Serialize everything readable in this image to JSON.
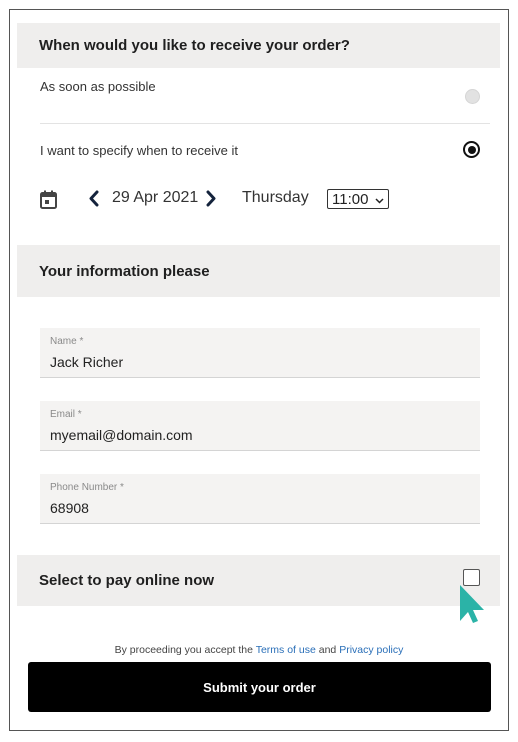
{
  "delivery": {
    "header": "When would you like to receive your order?",
    "option_asap": "As soon as possible",
    "option_specify": "I want to specify when to receive it",
    "selected": "specify",
    "date": "29 Apr 2021",
    "weekday": "Thursday",
    "time_value": "11:00",
    "calendar_icon": "calendar-icon",
    "prev_icon": "chevron-left-icon",
    "next_icon": "chevron-right-icon"
  },
  "info": {
    "header": "Your information please",
    "name_label": "Name *",
    "name_value": "Jack Richer",
    "email_label": "Email *",
    "email_value": "myemail@domain.com",
    "phone_label": "Phone Number *",
    "phone_value": "68908"
  },
  "payment": {
    "header": "Select to pay online now",
    "checked": false
  },
  "footer": {
    "terms_prefix": "By proceeding you accept the",
    "terms_link": "Terms of use",
    "terms_and": "and",
    "privacy_link": "Privacy policy",
    "submit_label": "Submit your order"
  },
  "colors": {
    "link": "#2a6fb8",
    "cursor": "#2bb3a7",
    "section_bg": "#efeeed",
    "submit_bg": "#000000"
  }
}
